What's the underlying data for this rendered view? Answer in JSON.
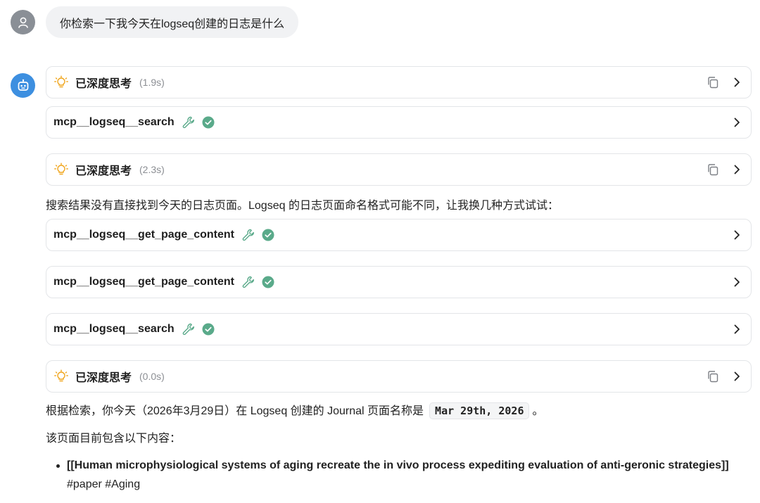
{
  "user_message": "你检索一下我今天在logseq创建的日志是什么",
  "steps": [
    {
      "kind": "think",
      "label": "已深度思考",
      "time": "(1.9s)"
    },
    {
      "kind": "tool",
      "label": "mcp__logseq__search"
    },
    {
      "kind": "think",
      "label": "已深度思考",
      "time": "(2.3s)"
    },
    {
      "kind": "tool",
      "label": "mcp__logseq__get_page_content"
    },
    {
      "kind": "tool",
      "label": "mcp__logseq__get_page_content"
    },
    {
      "kind": "tool",
      "label": "mcp__logseq__search"
    },
    {
      "kind": "think",
      "label": "已深度思考",
      "time": "(0.0s)"
    }
  ],
  "messages": {
    "retry_note": "搜索结果没有直接找到今天的日志页面。Logseq 的日志页面命名格式可能不同，让我换几种方式试试：",
    "answer_prefix": "根据检索，你今天（2026年3月29日）在 Logseq 创建的 Journal 页面名称是",
    "answer_code": "Mar 29th, 2026",
    "answer_suffix": "。",
    "content_intro": "该页面目前包含以下内容："
  },
  "bullets": [
    {
      "link": "[[Human microphysiological systems of aging recreate the in vivo process expediting evaluation of anti-geronic strategies]]",
      "tags": "#paper #Aging"
    }
  ],
  "icons": {
    "user_avatar": "person-icon",
    "bot_avatar": "robot-icon",
    "think": "lightbulb-icon",
    "tool": "wrench-icon",
    "status": "check-circle-icon",
    "copy": "copy-icon",
    "expand": "chevron-right-icon"
  },
  "colors": {
    "bot_avatar": "#3d8fe0",
    "user_avatar": "#8a8f96",
    "bulb": "#f0a51c",
    "wrench": "#5aaa8a",
    "check": "#5aaa8a"
  }
}
